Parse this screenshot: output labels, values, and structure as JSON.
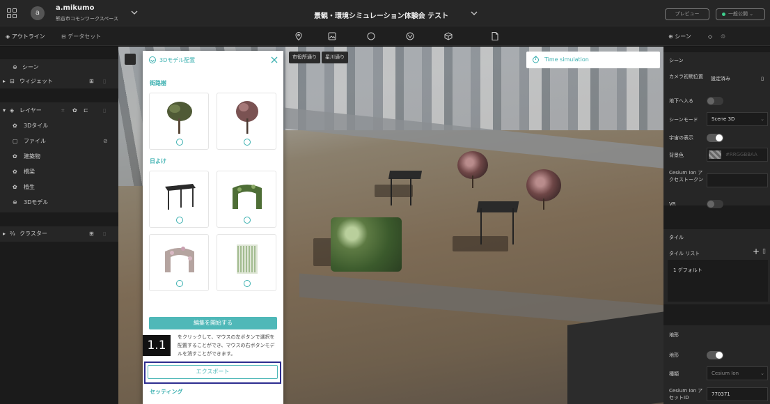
{
  "header": {
    "user_initial": "a",
    "user_name": "a.mikumo",
    "workspace_name": "熊谷市コモンワークスペース",
    "project_title": "景観・環境シミュレーション体験会 テスト",
    "preview_label": "プレビュー",
    "publish_label": "一般公開"
  },
  "toolbar": {
    "outline_tab": "アウトライン",
    "dataset_tab": "データセット",
    "scene_tab": "シーン",
    "tools": [
      "map-pin-icon",
      "image-icon",
      "circle-icon",
      "globe-pin-icon",
      "box-3d-icon",
      "file-icon"
    ]
  },
  "left_panel": {
    "scene": "シーン",
    "widget": "ウィジェット",
    "layer": "レイヤー",
    "layers": [
      {
        "label": "3Dタイル",
        "icon": "tiles-icon"
      },
      {
        "label": "ファイル",
        "icon": "file-icon"
      },
      {
        "label": "建築物",
        "icon": "tiles-icon"
      },
      {
        "label": "橋梁",
        "icon": "tiles-icon"
      },
      {
        "label": "植生",
        "icon": "tiles-icon"
      },
      {
        "label": "3Dモデル",
        "icon": "model-icon"
      }
    ],
    "cluster": "クラスター"
  },
  "viewport": {
    "chips": [
      "市役所通り",
      "星川通り"
    ],
    "time_simulation": "Time simulation"
  },
  "model_panel": {
    "title": "3Dモデル配置",
    "section_street_trees": "街路樹",
    "section_sunshade": "日よけ",
    "start_edit": "編集を開始する",
    "help_text": "をクリックして、マウスの左ボタンで選択を配置することができ、マウスの右ボタンモデルを消すことができます。",
    "step_badge": "1.1",
    "export": "エクスポート",
    "settings": "セッティング"
  },
  "right_panel": {
    "scene_section": "シーン",
    "camera_label": "カメラ初期位置",
    "camera_value": "設定済み",
    "underground_label": "地下へ入る",
    "scene_mode_label": "シーンモード",
    "scene_mode_value": "Scene 3D",
    "space_label": "宇宙の表示",
    "bg_label": "背景色",
    "bg_value": "#RRGGBBAA",
    "cesium_token_label": "Cesium Ion アクセストークン",
    "vr_label": "VR",
    "tile_section": "タイル",
    "tile_list_label": "タイル リスト",
    "tile_item": "1 デフォルト",
    "terrain_section": "地形",
    "terrain_label": "地形",
    "type_label": "種類",
    "type_value": "Cesium Ion",
    "asset_id_label": "Cesium Ion アセットID",
    "asset_id_value": "770371"
  },
  "colors": {
    "accent": "#3bb0b0",
    "highlight_box": "#2d2d8f"
  }
}
